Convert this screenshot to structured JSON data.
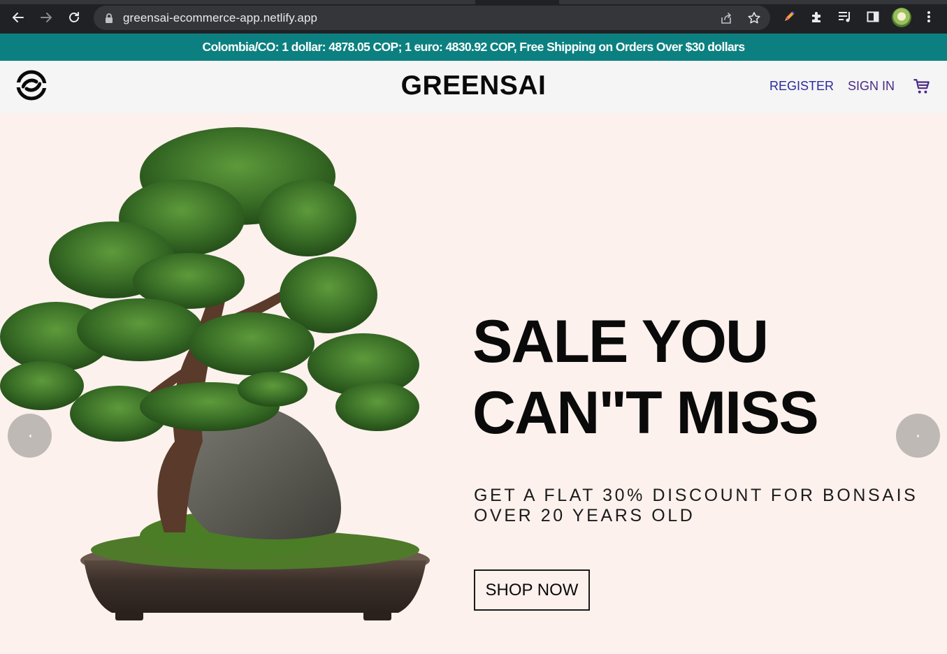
{
  "browser": {
    "url": "greensai-ecommerce-app.netlify.app",
    "icons": [
      "back-icon",
      "forward-icon",
      "reload-icon",
      "lock-icon",
      "share-icon",
      "bookmark-star-icon",
      "pen-extension-icon",
      "extensions-puzzle-icon",
      "media-queue-icon",
      "side-panel-icon",
      "profile-avatar",
      "more-menu-icon"
    ]
  },
  "announcement": {
    "text": "Colombia/CO: 1 dollar: 4878.05 COP; 1 euro: 4830.92 COP, Free Shipping on Orders Over $30 dollars"
  },
  "header": {
    "brand": "GREENSAI",
    "register_label": "REGISTER",
    "signin_label": "SIGN IN",
    "icons": [
      "greensai-logo",
      "cart-icon"
    ]
  },
  "hero": {
    "headline_line1": "SALE YOU",
    "headline_line2": "CAN\"T MISS",
    "subline_line1": "GET A FLAT 30% DISCOUNT FOR BONSAIS",
    "subline_line2": "OVER 20 YEARS OLD",
    "cta_label": "SHOP NOW",
    "image": "bonsai-tree-image",
    "icons": [
      "chevron-left-icon",
      "chevron-right-icon"
    ]
  },
  "colors": {
    "chrome_bg": "#202124",
    "omnibox_bg": "#35363a",
    "announcement_bg": "#0c8080",
    "header_bg": "#f5f5f5",
    "hero_bg": "#fcf1ed",
    "link_blue": "#2a2a9e",
    "link_purple": "#4b2a86",
    "carousel_arrow": "#bfb9b6"
  }
}
